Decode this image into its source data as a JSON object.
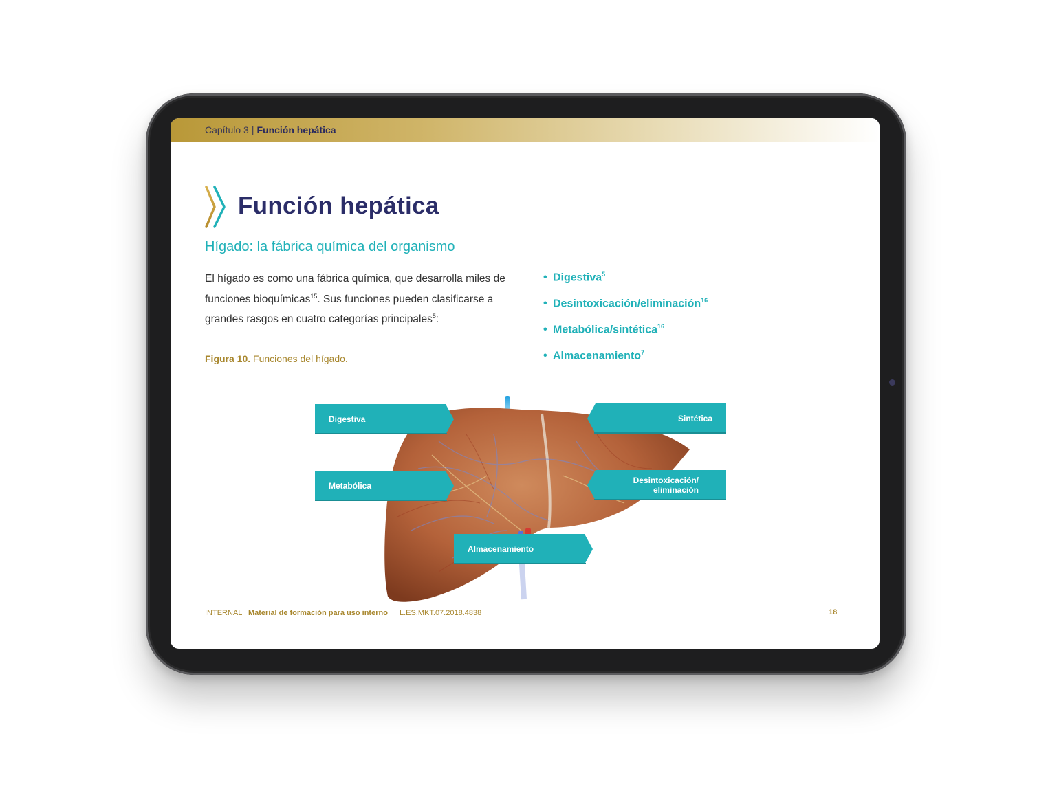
{
  "breadcrumb": {
    "chapter": "Capítulo 3",
    "separator": "|",
    "section": "Función hepática"
  },
  "page": {
    "title": "Función hepática",
    "subtitle": "Hígado: la fábrica química del organismo",
    "paragraph": {
      "part1": "El hígado es como una fábrica química, que desarrolla miles de funciones bioquímicas",
      "ref1": "15",
      "part2": ". Sus funciones pueden clasificarse a grandes rasgos en cuatro categorías principales",
      "ref2": "5",
      "part3": ":"
    },
    "figure_caption": {
      "label": "Figura 10.",
      "text": "Funciones del hígado."
    }
  },
  "bullets": [
    {
      "text": "Digestiva",
      "ref": "5"
    },
    {
      "text": "Desintoxicación/eliminación",
      "ref": "16"
    },
    {
      "text": "Metabólica/sintética",
      "ref": "16"
    },
    {
      "text": "Almacenamiento",
      "ref": "7"
    }
  ],
  "figure_labels": {
    "digestiva": "Digestiva",
    "metabolica": "Metabólica",
    "almacenamiento": "Almacenamiento",
    "sintetica": "Sintética",
    "desintoxicacion_line1": "Desintoxicación/",
    "desintoxicacion_line2": "eliminación"
  },
  "footer": {
    "internal": "INTERNAL",
    "separator": "|",
    "material": "Material de formación para uso interno",
    "code": "L.ES.MKT.07.2018.4838",
    "page_number": "18"
  },
  "colors": {
    "accent_teal": "#20b1b8",
    "title_navy": "#2b2d68",
    "gold": "#a8872e",
    "liver": "#b8653a"
  },
  "icons": {
    "title_marker": "double-chevron-icon",
    "device_camera": "camera-icon"
  }
}
